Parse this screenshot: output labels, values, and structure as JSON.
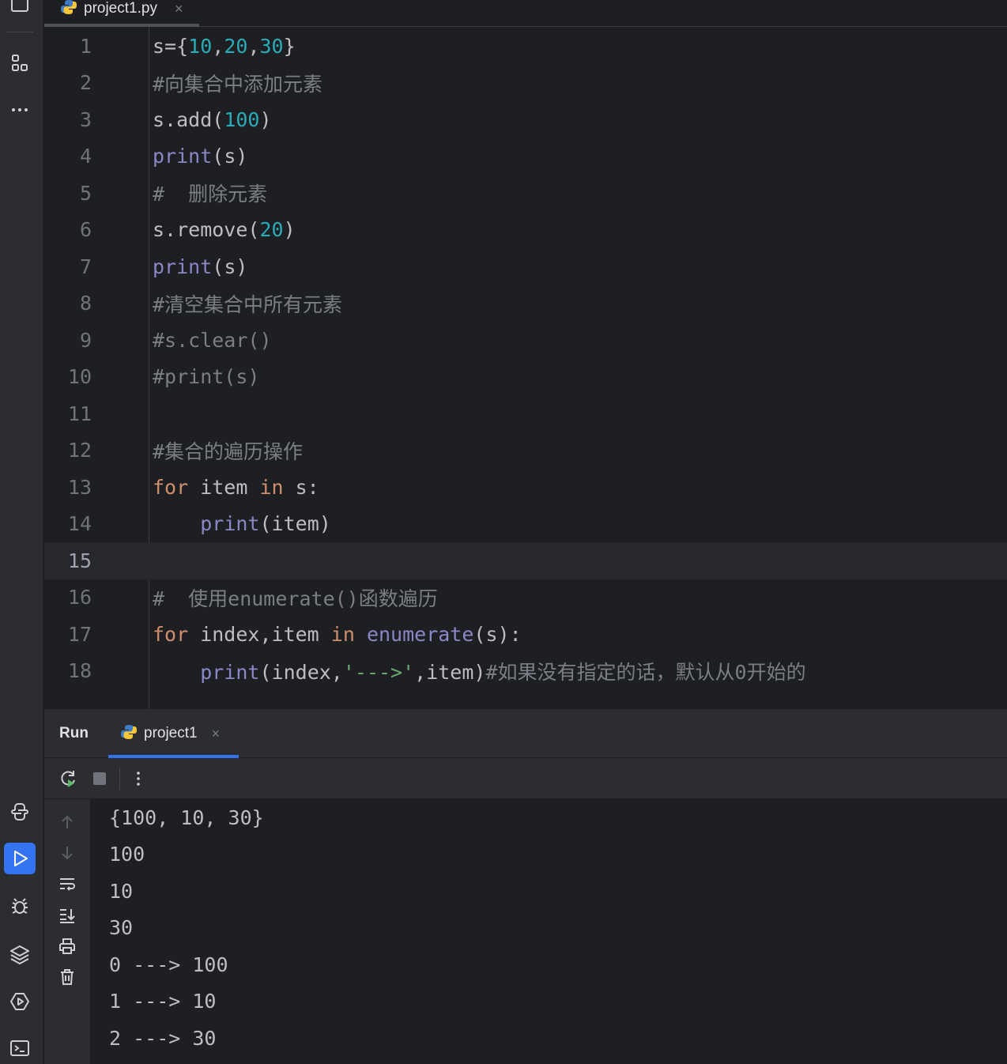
{
  "editor": {
    "tab_label": "project1.py",
    "tab_close": "×",
    "line_numbers": [
      "1",
      "2",
      "3",
      "4",
      "5",
      "6",
      "7",
      "8",
      "9",
      "10",
      "11",
      "12",
      "13",
      "14",
      "15",
      "16",
      "17",
      "18"
    ],
    "current_line": "15",
    "code": {
      "l1": {
        "a": "s={",
        "b": "10",
        "c": ",",
        "d": "20",
        "e": ",",
        "f": "30",
        "g": "}"
      },
      "l2": "#向集合中添加元素",
      "l3": {
        "a": "s.add(",
        "b": "100",
        "c": ")"
      },
      "l4": {
        "a": "print",
        "b": "(s)"
      },
      "l5": "#  删除元素",
      "l6": {
        "a": "s.remove(",
        "b": "20",
        "c": ")"
      },
      "l7": {
        "a": "print",
        "b": "(s)"
      },
      "l8": "#清空集合中所有元素",
      "l9": "#s.clear()",
      "l10": "#print(s)",
      "l12": "#集合的遍历操作",
      "l13": {
        "a": "for",
        "b": " item ",
        "c": "in",
        "d": " s:"
      },
      "l14": {
        "indent": "    ",
        "a": "print",
        "b": "(item)"
      },
      "l16": "#  使用enumerate()函数遍历",
      "l17": {
        "a": "for",
        "b": " index,item ",
        "c": "in",
        "d": " ",
        "e": "enumerate",
        "f": "(s):"
      },
      "l18": {
        "indent": "    ",
        "a": "print",
        "b": "(index,",
        "c": "'--->'",
        "d": ",item)",
        "e": "#如果没有指定的话，默认从0开始的"
      }
    }
  },
  "run_panel": {
    "title": "Run",
    "tab_label": "project1",
    "tab_close": "×",
    "output": [
      "{100, 10, 30}",
      "100",
      "10",
      "30",
      "0 ---> 100",
      "1 ---> 10",
      "2 ---> 30"
    ]
  },
  "colors": {
    "background": "#1e1f22",
    "panel": "#2b2d30",
    "keyword": "#cf8e6d",
    "builtin": "#8888c6",
    "number": "#2aacb8",
    "string": "#6aab73",
    "comment": "#7a7e85",
    "accent": "#3574f0"
  },
  "icons": [
    "project-icon",
    "structure-icon",
    "more-icon",
    "python-console-icon",
    "run-icon",
    "debug-icon",
    "layers-icon",
    "services-icon",
    "terminal-icon",
    "python-file-icon",
    "rerun-icon",
    "stop-icon",
    "options-icon",
    "scroll-up-icon",
    "scroll-down-icon",
    "soft-wrap-icon",
    "scroll-to-end-icon",
    "print-icon",
    "trash-icon"
  ]
}
